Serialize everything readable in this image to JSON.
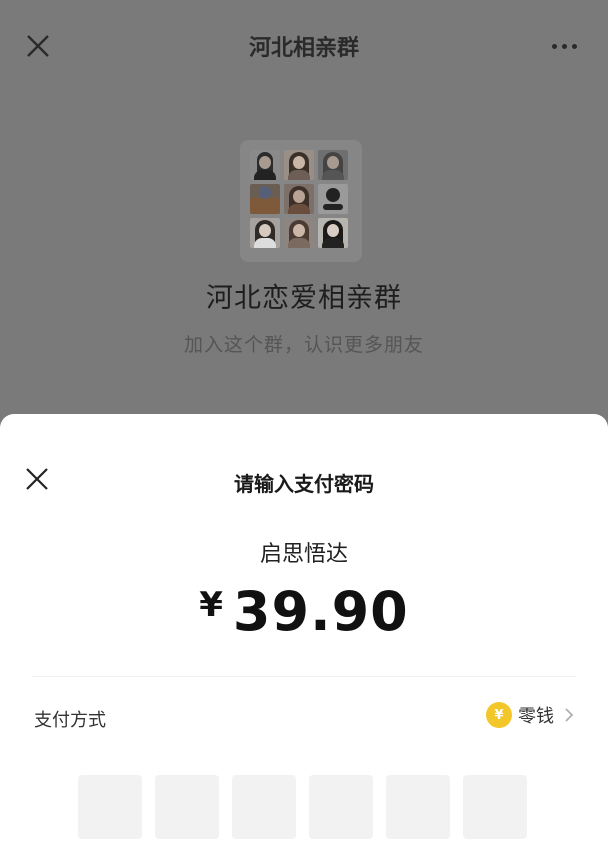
{
  "top_bar": {
    "title": "河北相亲群"
  },
  "group": {
    "name": "河北恋爱相亲群",
    "subtitle": "加入这个群，认识更多朋友"
  },
  "payment": {
    "title": "请输入支付密码",
    "payee": "启思悟达",
    "currency": "¥",
    "amount": "39.90",
    "method_label": "支付方式",
    "method_value": "零钱",
    "method_icon_text": "¥",
    "pin_length": 6
  },
  "colors": {
    "overlay_bg": "#7a7a7a",
    "sheet_bg": "#ffffff",
    "coin": "#f3c62a",
    "pin_box": "#f2f2f2"
  },
  "icons": {
    "top_close": "close-icon",
    "top_more": "more-icon",
    "sheet_close": "close-icon",
    "method_arrow": "chevron-right-icon",
    "method_coin": "wallet-coin-icon"
  }
}
